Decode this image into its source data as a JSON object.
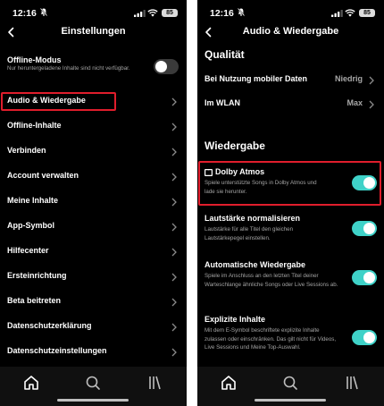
{
  "status": {
    "time": "12:16",
    "battery": "85"
  },
  "left": {
    "title": "Einstellungen",
    "offline": {
      "label": "Offline-Modus",
      "description": "Nur heruntergeladene Inhalte sind nicht verfügbar.",
      "toggle": "off"
    },
    "items": [
      {
        "label": "Audio & Wiedergabe"
      },
      {
        "label": "Offline-Inhalte"
      },
      {
        "label": "Verbinden"
      },
      {
        "label": "Account verwalten"
      },
      {
        "label": "Meine Inhalte"
      },
      {
        "label": "App-Symbol"
      },
      {
        "label": "Hilfecenter"
      },
      {
        "label": "Ersteinrichtung"
      },
      {
        "label": "Beta beitreten"
      },
      {
        "label": "Datenschutzerklärung"
      },
      {
        "label": "Datenschutzeinstellungen"
      }
    ]
  },
  "right": {
    "title": "Audio & Wiedergabe",
    "quality": {
      "section": "Qualität",
      "mobile": {
        "label": "Bei Nutzung mobiler Daten",
        "value": "Niedrig"
      },
      "wlan": {
        "label": "Im WLAN",
        "value": "Max"
      }
    },
    "playback": {
      "section": "Wiedergabe",
      "dolby": {
        "label": "Dolby Atmos",
        "description": "Spiele unterstützte Songs in Dolby Atmos und lade sie herunter.",
        "toggle": "on"
      },
      "normalize": {
        "label": "Lautstärke normalisieren",
        "description": "Lautstärke für alle Titel den gleichen Lautstärkepegel einstellen.",
        "toggle": "on"
      },
      "autoplay": {
        "label": "Automatische Wiedergabe",
        "description": "Spiele im Anschluss an den letzten Titel deiner Warteschlange ähnliche Songs oder Live Sessions ab.",
        "toggle": "on"
      },
      "explicit": {
        "label": "Explizite Inhalte",
        "description": "Mit dem E-Symbol beschriftete explizite Inhalte zulassen oder einschränken. Das gilt nicht für Videos, Live Sessions und Meine Top-Auswahl.",
        "toggle": "on"
      }
    }
  },
  "tabs": [
    "home-icon",
    "search-icon",
    "library-icon"
  ],
  "colors": {
    "accent": "#3fd2c8",
    "highlight": "#e01d2c",
    "background": "#000000"
  }
}
